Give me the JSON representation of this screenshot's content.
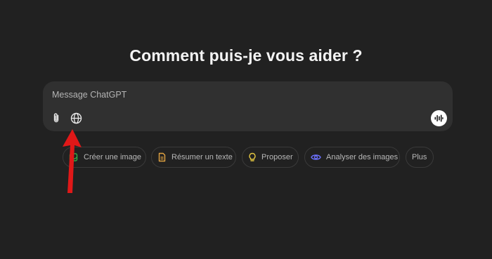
{
  "heading": "Comment puis-je vous aider ?",
  "composer": {
    "placeholder": "Message ChatGPT",
    "icons": [
      "paperclip-icon",
      "globe-icon",
      "voice-wave-icon"
    ]
  },
  "chips": [
    {
      "label": "Créer une image",
      "icon": "image-create-icon",
      "color": "#35ae47"
    },
    {
      "label": "Résumer un texte",
      "icon": "document-icon",
      "color": "#e2c541"
    },
    {
      "label": "Proposer",
      "icon": "lightbulb-icon",
      "color": "#e2c541"
    },
    {
      "label": "Analyser des images",
      "icon": "eye-icon",
      "color": "#6c71ff"
    },
    {
      "label": "Plus",
      "icon": "",
      "color": ""
    }
  ],
  "annotation": {
    "icon": "red-arrow-icon",
    "color": "#e01818"
  }
}
